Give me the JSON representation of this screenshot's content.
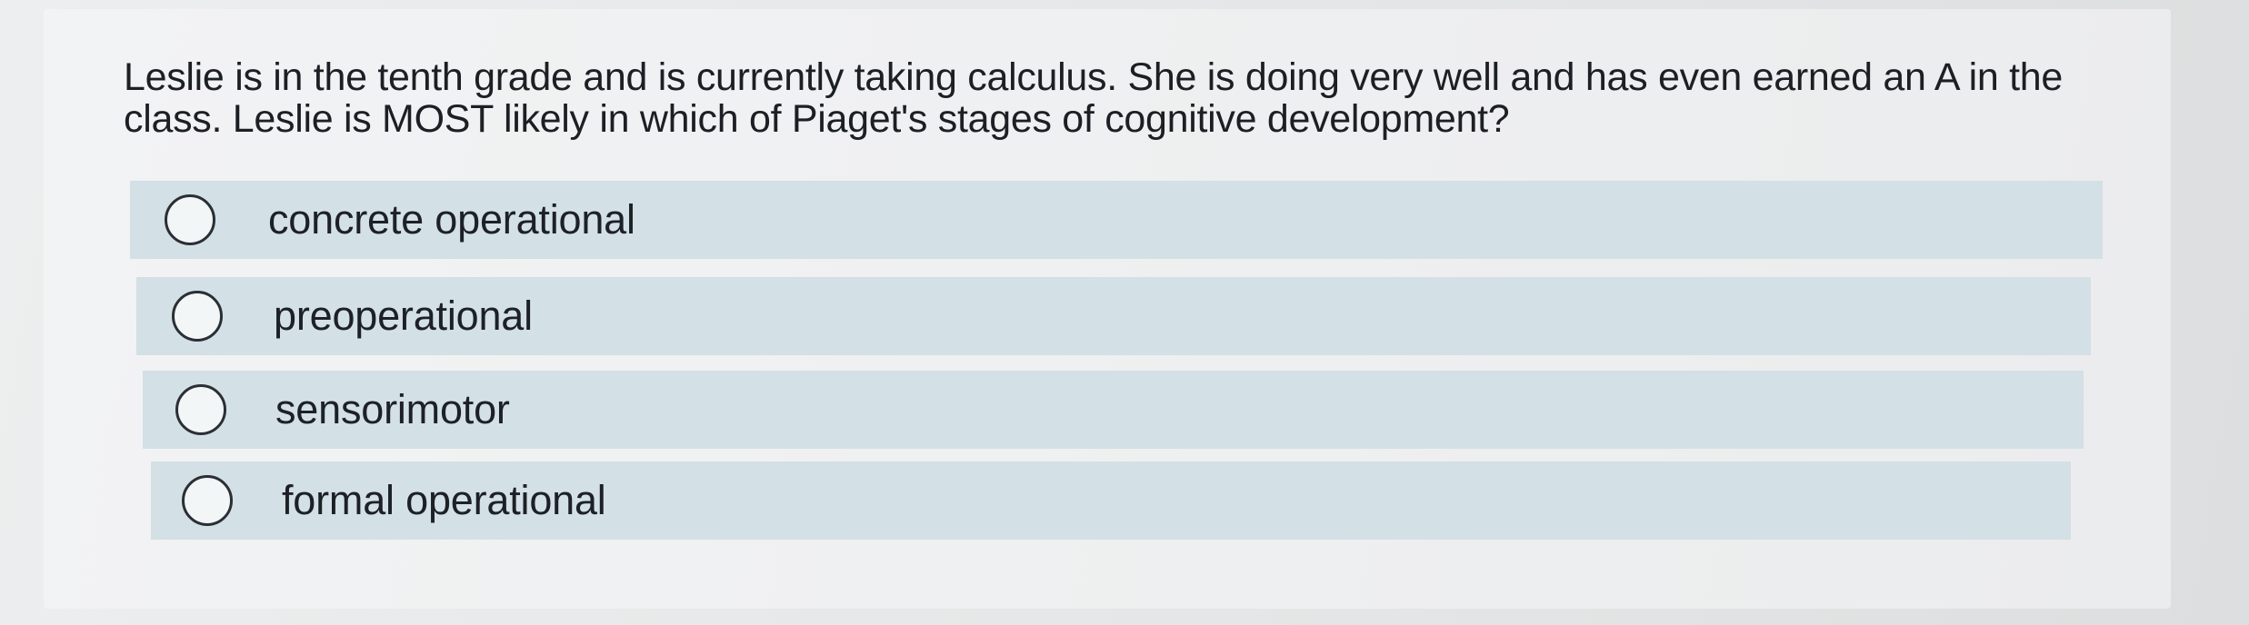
{
  "question": {
    "text": "Leslie is in the tenth grade and is currently taking calculus. She is doing very well and has even earned an A in the class. Leslie is MOST likely in which of Piaget's stages of cognitive development?"
  },
  "options": [
    {
      "label": "concrete operational",
      "selected": false
    },
    {
      "label": "preoperational",
      "selected": false
    },
    {
      "label": "sensorimotor",
      "selected": false
    },
    {
      "label": "formal operational",
      "selected": false
    }
  ],
  "colors": {
    "option_background": "#d3e0e6",
    "card_background": "#eff0f1",
    "text": "#1c1f23"
  }
}
